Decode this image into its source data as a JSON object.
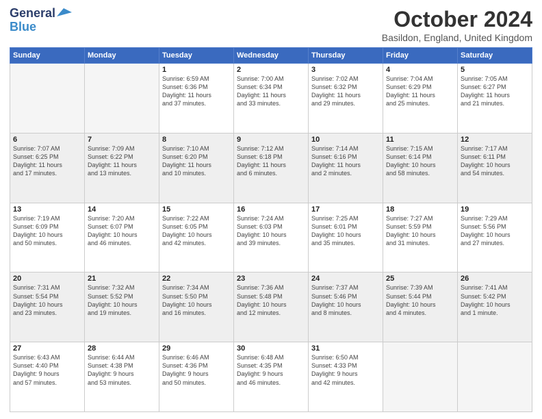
{
  "logo": {
    "line1": "General",
    "line2": "Blue"
  },
  "title": "October 2024",
  "subtitle": "Basildon, England, United Kingdom",
  "days_of_week": [
    "Sunday",
    "Monday",
    "Tuesday",
    "Wednesday",
    "Thursday",
    "Friday",
    "Saturday"
  ],
  "weeks": [
    [
      {
        "day": "",
        "detail": ""
      },
      {
        "day": "",
        "detail": ""
      },
      {
        "day": "1",
        "detail": "Sunrise: 6:59 AM\nSunset: 6:36 PM\nDaylight: 11 hours\nand 37 minutes."
      },
      {
        "day": "2",
        "detail": "Sunrise: 7:00 AM\nSunset: 6:34 PM\nDaylight: 11 hours\nand 33 minutes."
      },
      {
        "day": "3",
        "detail": "Sunrise: 7:02 AM\nSunset: 6:32 PM\nDaylight: 11 hours\nand 29 minutes."
      },
      {
        "day": "4",
        "detail": "Sunrise: 7:04 AM\nSunset: 6:29 PM\nDaylight: 11 hours\nand 25 minutes."
      },
      {
        "day": "5",
        "detail": "Sunrise: 7:05 AM\nSunset: 6:27 PM\nDaylight: 11 hours\nand 21 minutes."
      }
    ],
    [
      {
        "day": "6",
        "detail": "Sunrise: 7:07 AM\nSunset: 6:25 PM\nDaylight: 11 hours\nand 17 minutes."
      },
      {
        "day": "7",
        "detail": "Sunrise: 7:09 AM\nSunset: 6:22 PM\nDaylight: 11 hours\nand 13 minutes."
      },
      {
        "day": "8",
        "detail": "Sunrise: 7:10 AM\nSunset: 6:20 PM\nDaylight: 11 hours\nand 10 minutes."
      },
      {
        "day": "9",
        "detail": "Sunrise: 7:12 AM\nSunset: 6:18 PM\nDaylight: 11 hours\nand 6 minutes."
      },
      {
        "day": "10",
        "detail": "Sunrise: 7:14 AM\nSunset: 6:16 PM\nDaylight: 11 hours\nand 2 minutes."
      },
      {
        "day": "11",
        "detail": "Sunrise: 7:15 AM\nSunset: 6:14 PM\nDaylight: 10 hours\nand 58 minutes."
      },
      {
        "day": "12",
        "detail": "Sunrise: 7:17 AM\nSunset: 6:11 PM\nDaylight: 10 hours\nand 54 minutes."
      }
    ],
    [
      {
        "day": "13",
        "detail": "Sunrise: 7:19 AM\nSunset: 6:09 PM\nDaylight: 10 hours\nand 50 minutes."
      },
      {
        "day": "14",
        "detail": "Sunrise: 7:20 AM\nSunset: 6:07 PM\nDaylight: 10 hours\nand 46 minutes."
      },
      {
        "day": "15",
        "detail": "Sunrise: 7:22 AM\nSunset: 6:05 PM\nDaylight: 10 hours\nand 42 minutes."
      },
      {
        "day": "16",
        "detail": "Sunrise: 7:24 AM\nSunset: 6:03 PM\nDaylight: 10 hours\nand 39 minutes."
      },
      {
        "day": "17",
        "detail": "Sunrise: 7:25 AM\nSunset: 6:01 PM\nDaylight: 10 hours\nand 35 minutes."
      },
      {
        "day": "18",
        "detail": "Sunrise: 7:27 AM\nSunset: 5:59 PM\nDaylight: 10 hours\nand 31 minutes."
      },
      {
        "day": "19",
        "detail": "Sunrise: 7:29 AM\nSunset: 5:56 PM\nDaylight: 10 hours\nand 27 minutes."
      }
    ],
    [
      {
        "day": "20",
        "detail": "Sunrise: 7:31 AM\nSunset: 5:54 PM\nDaylight: 10 hours\nand 23 minutes."
      },
      {
        "day": "21",
        "detail": "Sunrise: 7:32 AM\nSunset: 5:52 PM\nDaylight: 10 hours\nand 19 minutes."
      },
      {
        "day": "22",
        "detail": "Sunrise: 7:34 AM\nSunset: 5:50 PM\nDaylight: 10 hours\nand 16 minutes."
      },
      {
        "day": "23",
        "detail": "Sunrise: 7:36 AM\nSunset: 5:48 PM\nDaylight: 10 hours\nand 12 minutes."
      },
      {
        "day": "24",
        "detail": "Sunrise: 7:37 AM\nSunset: 5:46 PM\nDaylight: 10 hours\nand 8 minutes."
      },
      {
        "day": "25",
        "detail": "Sunrise: 7:39 AM\nSunset: 5:44 PM\nDaylight: 10 hours\nand 4 minutes."
      },
      {
        "day": "26",
        "detail": "Sunrise: 7:41 AM\nSunset: 5:42 PM\nDaylight: 10 hours\nand 1 minute."
      }
    ],
    [
      {
        "day": "27",
        "detail": "Sunrise: 6:43 AM\nSunset: 4:40 PM\nDaylight: 9 hours\nand 57 minutes."
      },
      {
        "day": "28",
        "detail": "Sunrise: 6:44 AM\nSunset: 4:38 PM\nDaylight: 9 hours\nand 53 minutes."
      },
      {
        "day": "29",
        "detail": "Sunrise: 6:46 AM\nSunset: 4:36 PM\nDaylight: 9 hours\nand 50 minutes."
      },
      {
        "day": "30",
        "detail": "Sunrise: 6:48 AM\nSunset: 4:35 PM\nDaylight: 9 hours\nand 46 minutes."
      },
      {
        "day": "31",
        "detail": "Sunrise: 6:50 AM\nSunset: 4:33 PM\nDaylight: 9 hours\nand 42 minutes."
      },
      {
        "day": "",
        "detail": ""
      },
      {
        "day": "",
        "detail": ""
      }
    ]
  ]
}
